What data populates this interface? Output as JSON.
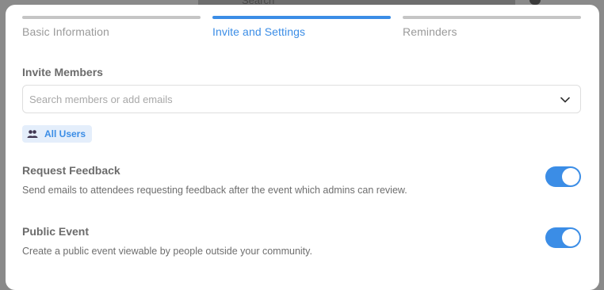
{
  "backdrop": {
    "search_label": "Search"
  },
  "steps": [
    {
      "label": "Basic Information",
      "active": false
    },
    {
      "label": "Invite and Settings",
      "active": true
    },
    {
      "label": "Reminders",
      "active": false
    }
  ],
  "invite": {
    "title": "Invite Members",
    "placeholder": "Search members or add emails",
    "chip_label": "All Users",
    "chip_icon": "users-icon"
  },
  "request_feedback": {
    "title": "Request Feedback",
    "description": "Send emails to attendees requesting feedback after the event which admins can review.",
    "enabled": true
  },
  "public_event": {
    "title": "Public Event",
    "description": "Create a public event viewable by people outside your community.",
    "enabled": true
  },
  "colors": {
    "accent": "#3b8de6",
    "inactive_step": "#c5c5c5",
    "chip_bg": "#e4eefb"
  }
}
